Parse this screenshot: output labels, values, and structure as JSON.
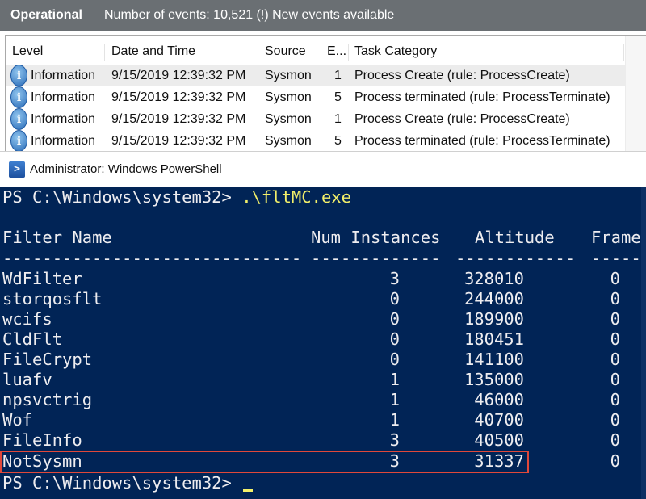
{
  "event_viewer": {
    "log_name": "Operational",
    "summary": "Number of events: 10,521 (!) New events available",
    "columns": [
      "Level",
      "Date and Time",
      "Source",
      "E...",
      "Task Category"
    ],
    "rows": [
      {
        "level": "Information",
        "datetime": "9/15/2019 12:39:32 PM",
        "source": "Sysmon",
        "event_id": "1",
        "task": "Process Create (rule: ProcessCreate)"
      },
      {
        "level": "Information",
        "datetime": "9/15/2019 12:39:32 PM",
        "source": "Sysmon",
        "event_id": "5",
        "task": "Process terminated (rule: ProcessTerminate)"
      },
      {
        "level": "Information",
        "datetime": "9/15/2019 12:39:32 PM",
        "source": "Sysmon",
        "event_id": "1",
        "task": "Process Create (rule: ProcessCreate)"
      },
      {
        "level": "Information",
        "datetime": "9/15/2019 12:39:32 PM",
        "source": "Sysmon",
        "event_id": "5",
        "task": "Process terminated (rule: ProcessTerminate)"
      }
    ],
    "info_icon_glyph": "i"
  },
  "powershell": {
    "title": "Administrator: Windows PowerShell",
    "logo_glyph": ">",
    "prompt": "PS C:\\Windows\\system32> ",
    "command": ".\\fltMC.exe",
    "headers": [
      "Filter Name",
      "Num Instances",
      "Altitude",
      "Frame"
    ],
    "separators": [
      "------------------------------",
      "-------------",
      "------------",
      "-----"
    ],
    "filters": [
      {
        "name": "WdFilter",
        "instances": "3",
        "altitude": "328010",
        "frame": "0"
      },
      {
        "name": "storqosflt",
        "instances": "0",
        "altitude": "244000",
        "frame": "0"
      },
      {
        "name": "wcifs",
        "instances": "0",
        "altitude": "189900",
        "frame": "0"
      },
      {
        "name": "CldFlt",
        "instances": "0",
        "altitude": "180451",
        "frame": "0"
      },
      {
        "name": "FileCrypt",
        "instances": "0",
        "altitude": "141100",
        "frame": "0"
      },
      {
        "name": "luafv",
        "instances": "1",
        "altitude": "135000",
        "frame": "0"
      },
      {
        "name": "npsvctrig",
        "instances": "1",
        "altitude": "46000",
        "frame": "0"
      },
      {
        "name": "Wof",
        "instances": "1",
        "altitude": "40700",
        "frame": "0"
      },
      {
        "name": "FileInfo",
        "instances": "3",
        "altitude": "40500",
        "frame": "0"
      },
      {
        "name": "NotSysmn",
        "instances": "3",
        "altitude": "31337",
        "frame": "0"
      }
    ],
    "final_prompt": "PS C:\\Windows\\system32> "
  },
  "colors": {
    "console_bg": "#012456",
    "console_text": "#eeedf0",
    "command_text": "#f2ef6a",
    "highlight_border": "#e0483a",
    "event_header_bg": "#6a6f73"
  }
}
